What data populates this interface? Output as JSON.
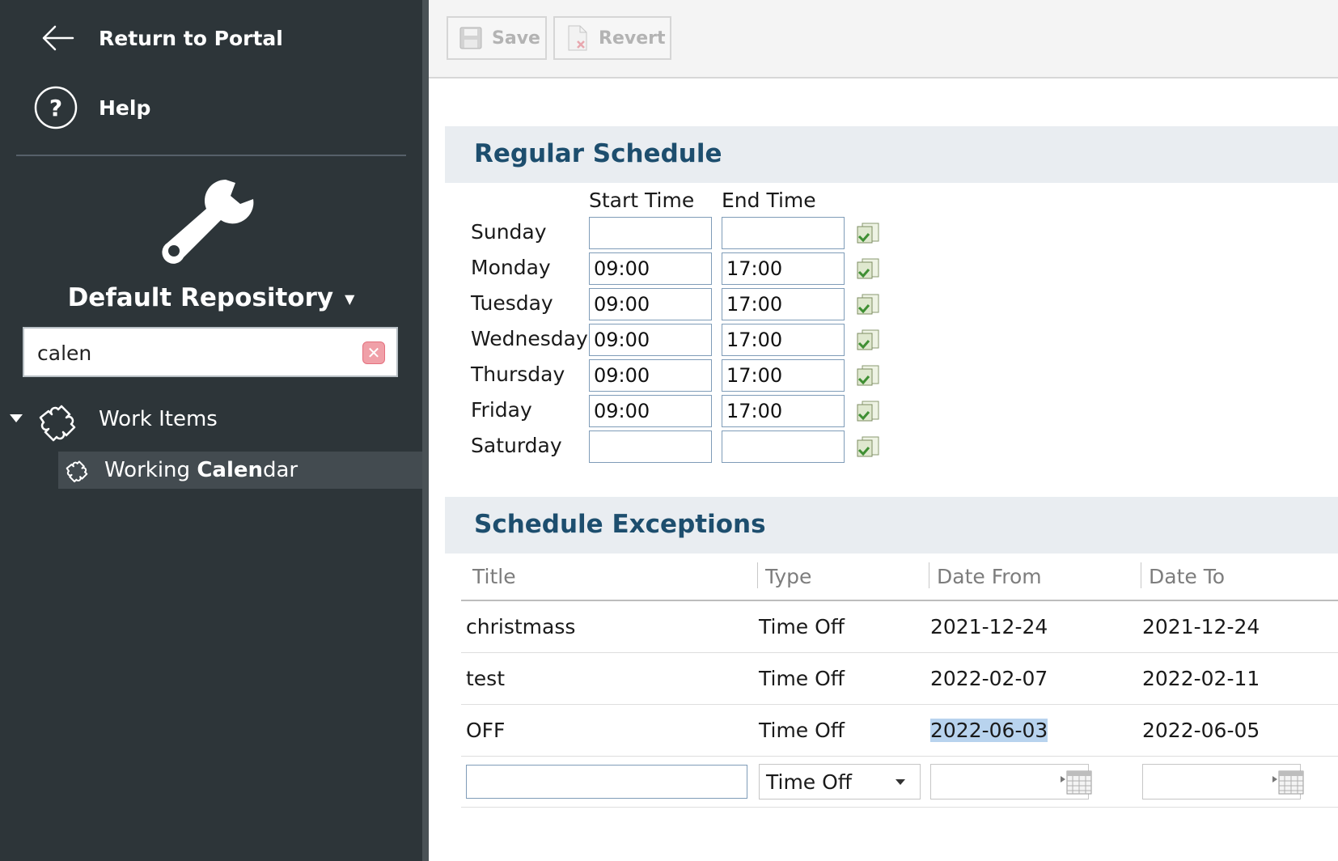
{
  "sidebar": {
    "return_label": "Return to Portal",
    "help_label": "Help",
    "repository_label": "Default Repository",
    "search": {
      "value": "calen",
      "placeholder": ""
    },
    "tree": {
      "parent_label": "Work Items",
      "child_label_prefix": "Working ",
      "child_label_match": "Calen",
      "child_label_suffix": "dar"
    }
  },
  "toolbar": {
    "save_label": "Save",
    "revert_label": "Revert"
  },
  "regular_schedule": {
    "title": "Regular Schedule",
    "start_header": "Start Time",
    "end_header": "End Time",
    "days": [
      {
        "day": "Sunday",
        "start": "",
        "end": ""
      },
      {
        "day": "Monday",
        "start": "09:00",
        "end": "17:00"
      },
      {
        "day": "Tuesday",
        "start": "09:00",
        "end": "17:00"
      },
      {
        "day": "Wednesday",
        "start": "09:00",
        "end": "17:00"
      },
      {
        "day": "Thursday",
        "start": "09:00",
        "end": "17:00"
      },
      {
        "day": "Friday",
        "start": "09:00",
        "end": "17:00"
      },
      {
        "day": "Saturday",
        "start": "",
        "end": ""
      }
    ]
  },
  "exceptions": {
    "title": "Schedule Exceptions",
    "columns": [
      "Title",
      "Type",
      "Date From",
      "Date To"
    ],
    "rows": [
      {
        "title": "christmass",
        "type": "Time Off",
        "from": "2021-12-24",
        "to": "2021-12-24"
      },
      {
        "title": "test",
        "type": "Time Off",
        "from": "2022-02-07",
        "to": "2022-02-11"
      },
      {
        "title": "OFF",
        "type": "Time Off",
        "from": "2022-06-03",
        "to": "2022-06-05"
      }
    ],
    "new_row": {
      "title": "",
      "type": "Time Off",
      "from": "",
      "to": ""
    }
  },
  "colors": {
    "sidebar_bg": "#2d3539",
    "section_title": "#1d4e6e",
    "section_bg": "#e9edf1",
    "selection": "#b8d3ee"
  }
}
